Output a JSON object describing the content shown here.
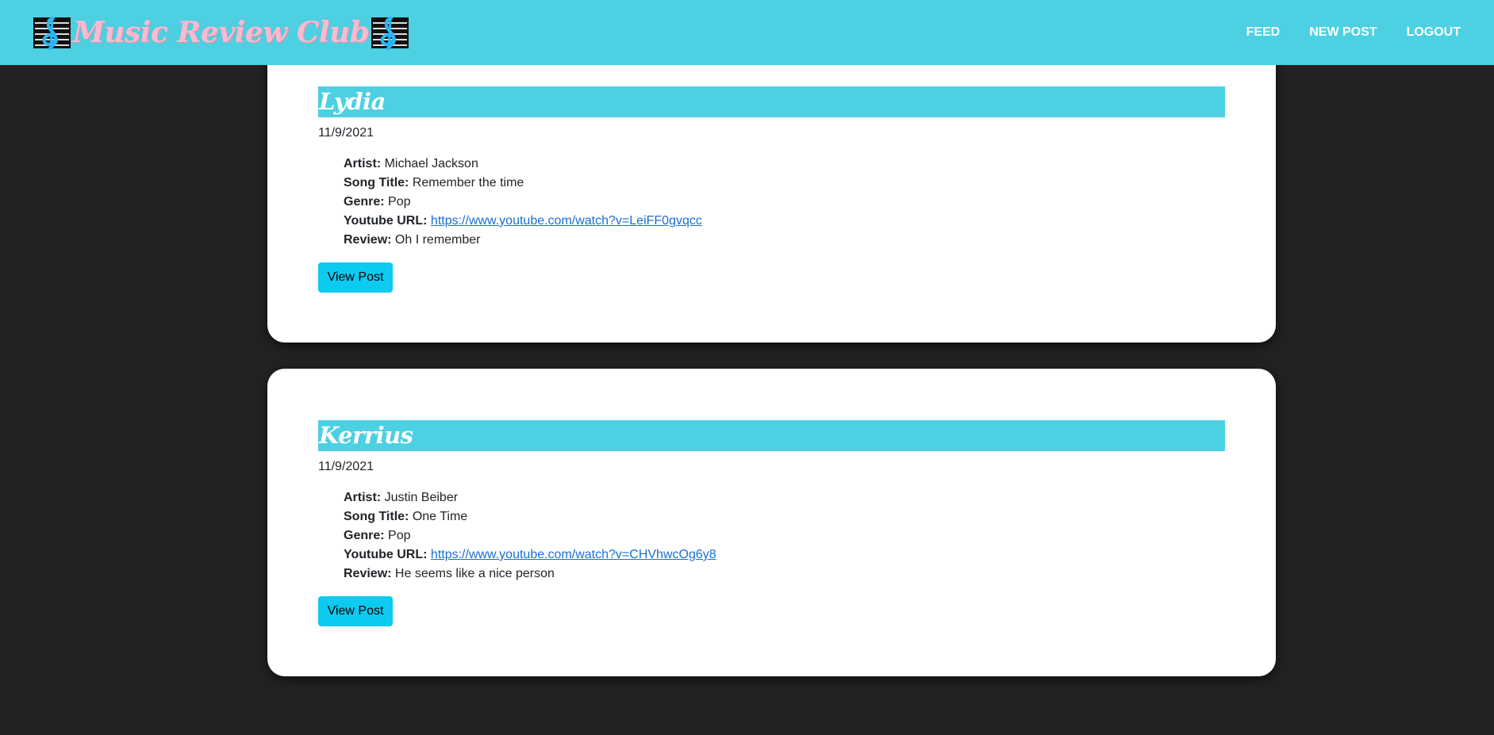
{
  "brand": {
    "title": "Music Review Club",
    "left_icon": "treble-clef-icon",
    "right_icon": "treble-clef-icon"
  },
  "nav": {
    "feed": "FEED",
    "new_post": "NEW POST",
    "logout": "LOGOUT"
  },
  "colors": {
    "navbar": "#4dd0e1",
    "brand_text": "#f8bbd0",
    "background": "#222222",
    "card": "#ffffff",
    "button": "#0dcaf0",
    "link": "#1a6fd1"
  },
  "labels": {
    "artist": "Artist:",
    "song_title": "Song Title:",
    "genre": "Genre:",
    "youtube_url": "Youtube URL:",
    "review": "Review:"
  },
  "posts": [
    {
      "author": "Lydia",
      "date": "11/9/2021",
      "artist": "Michael Jackson",
      "song_title": "Remember the time",
      "genre": "Pop",
      "youtube_url": "https://www.youtube.com/watch?v=LeiFF0gvqcc",
      "review": "Oh I remember",
      "button": "View Post"
    },
    {
      "author": "Kerrius",
      "date": "11/9/2021",
      "artist": "Justin Beiber",
      "song_title": "One Time",
      "genre": "Pop",
      "youtube_url": "https://www.youtube.com/watch?v=CHVhwcOg6y8",
      "review": "He seems like a nice person",
      "button": "View Post"
    }
  ]
}
